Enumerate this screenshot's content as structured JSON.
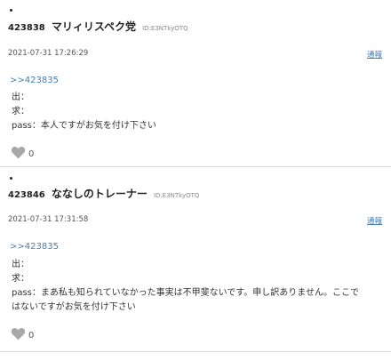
{
  "posts": [
    {
      "number": "423838",
      "name": "マリィリスペク党",
      "id": "ID:E3NTkyOTQ",
      "date": "2021-07-31 17:26:29",
      "report_label": "通報",
      "anchor": ">>423835",
      "lines": [
        "出：",
        "求：",
        "pass：本人ですがお気を付け下さい"
      ],
      "likes": "0"
    },
    {
      "number": "423846",
      "name": "ななしのトレーナー",
      "id": "ID:E3NTkyOTQ",
      "date": "2021-07-31 17:31:58",
      "report_label": "通報",
      "anchor": ">>423835",
      "lines": [
        "出：",
        "求：",
        "pass：まあ私も知られていなかった事実は不甲斐ないです。申し訳ありません。ここで",
        "はないですがお気を付け下さい"
      ],
      "likes": "0"
    }
  ],
  "colors": {
    "link": "#4a7db0",
    "heart": "#a8a8a8"
  }
}
